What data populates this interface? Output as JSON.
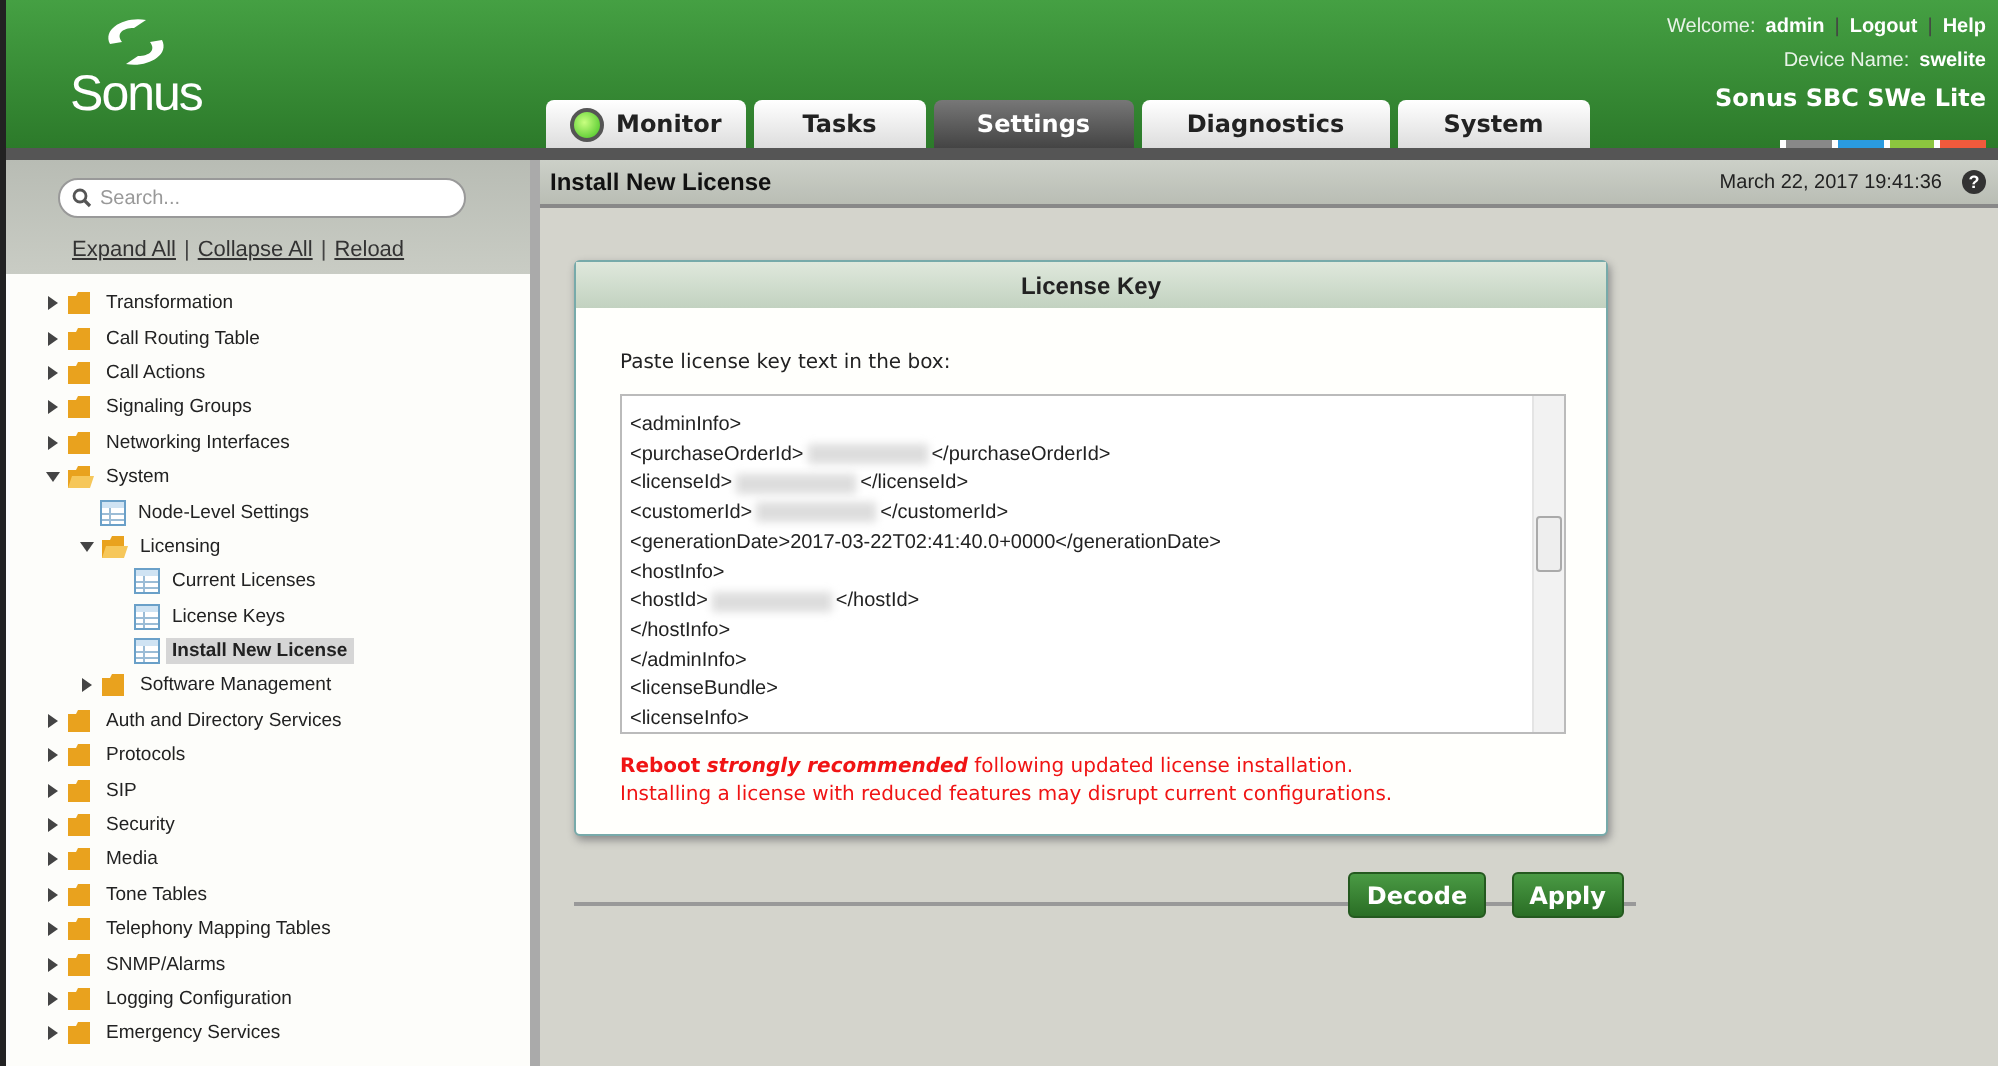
{
  "header": {
    "brand": "Sonus",
    "welcome_label": "Welcome:",
    "user": "admin",
    "links": [
      "Logout",
      "Help"
    ],
    "link_separator": "|",
    "device_label": "Device Name:",
    "device_name": "swelite",
    "product": "Sonus SBC SWe Lite"
  },
  "tabs": [
    {
      "label": "Monitor",
      "selected": false,
      "status_light": true
    },
    {
      "label": "Tasks",
      "selected": false,
      "status_light": false
    },
    {
      "label": "Settings",
      "selected": true,
      "status_light": false
    },
    {
      "label": "Diagnostics",
      "selected": false,
      "status_light": false
    },
    {
      "label": "System",
      "selected": false,
      "status_light": false
    }
  ],
  "sidebar": {
    "search": {
      "placeholder": "Search..."
    },
    "links": [
      "Expand All",
      "Collapse All",
      "Reload"
    ],
    "link_separator": "|",
    "tree": [
      {
        "label": "Transformation",
        "kind": "folder",
        "expanded": false,
        "selected": false
      },
      {
        "label": "Call Routing Table",
        "kind": "folder",
        "expanded": false,
        "selected": false
      },
      {
        "label": "Call Actions",
        "kind": "folder",
        "expanded": false,
        "selected": false
      },
      {
        "label": "Signaling Groups",
        "kind": "folder",
        "expanded": false,
        "selected": false
      },
      {
        "label": "Networking Interfaces",
        "kind": "folder",
        "expanded": false,
        "selected": false
      },
      {
        "label": "System",
        "kind": "folder",
        "expanded": true,
        "selected": false,
        "children": [
          {
            "label": "Node-Level Settings",
            "kind": "page",
            "selected": false
          },
          {
            "label": "Licensing",
            "kind": "folder",
            "expanded": true,
            "selected": false,
            "children": [
              {
                "label": "Current Licenses",
                "kind": "page",
                "selected": false
              },
              {
                "label": "License Keys",
                "kind": "page",
                "selected": false
              },
              {
                "label": "Install New License",
                "kind": "page",
                "selected": true
              }
            ]
          },
          {
            "label": "Software Management",
            "kind": "folder",
            "expanded": false,
            "selected": false
          }
        ]
      },
      {
        "label": "Auth and Directory Services",
        "kind": "folder",
        "expanded": false,
        "selected": false
      },
      {
        "label": "Protocols",
        "kind": "folder",
        "expanded": false,
        "selected": false
      },
      {
        "label": "SIP",
        "kind": "folder",
        "expanded": false,
        "selected": false
      },
      {
        "label": "Security",
        "kind": "folder",
        "expanded": false,
        "selected": false
      },
      {
        "label": "Media",
        "kind": "folder",
        "expanded": false,
        "selected": false
      },
      {
        "label": "Tone Tables",
        "kind": "folder",
        "expanded": false,
        "selected": false
      },
      {
        "label": "Telephony Mapping Tables",
        "kind": "folder",
        "expanded": false,
        "selected": false
      },
      {
        "label": "SNMP/Alarms",
        "kind": "folder",
        "expanded": false,
        "selected": false
      },
      {
        "label": "Logging Configuration",
        "kind": "folder",
        "expanded": false,
        "selected": false
      },
      {
        "label": "Emergency Services",
        "kind": "folder",
        "expanded": false,
        "selected": false
      }
    ]
  },
  "content": {
    "title": "Install New License",
    "timestamp": "March 22, 2017 19:41:36",
    "help": "?",
    "panel": {
      "title": "License Key",
      "instruction": "Paste license key text in the box:",
      "key_lines": [
        {
          "text": "<adminInfo>",
          "blurred": false
        },
        {
          "text": "<purchaseOrderId>",
          "blurred": true,
          "after": "</purchaseOrderId>"
        },
        {
          "text": "<licenseId>",
          "blurred": true,
          "after": "</licenseId>"
        },
        {
          "text": "<customerId>",
          "blurred": true,
          "after": "</customerId>"
        },
        {
          "text": "<generationDate>2017-03-22T02:41:40.0+0000</generationDate>",
          "blurred": false
        },
        {
          "text": "<hostInfo>",
          "blurred": false
        },
        {
          "text": "<hostId>",
          "blurred": true,
          "after": "</hostId>"
        },
        {
          "text": "</hostInfo>",
          "blurred": false
        },
        {
          "text": "</adminInfo>",
          "blurred": false
        },
        {
          "text": "<licenseBundle>",
          "blurred": false
        },
        {
          "text": "<licenseInfo>",
          "blurred": false
        }
      ],
      "warning": {
        "lead": "Reboot",
        "emphasis": "strongly recommended",
        "rest": "following updated license installation."
      },
      "note": "Installing a license with reduced features may disrupt current configurations."
    },
    "buttons": [
      "Decode",
      "Apply"
    ]
  }
}
